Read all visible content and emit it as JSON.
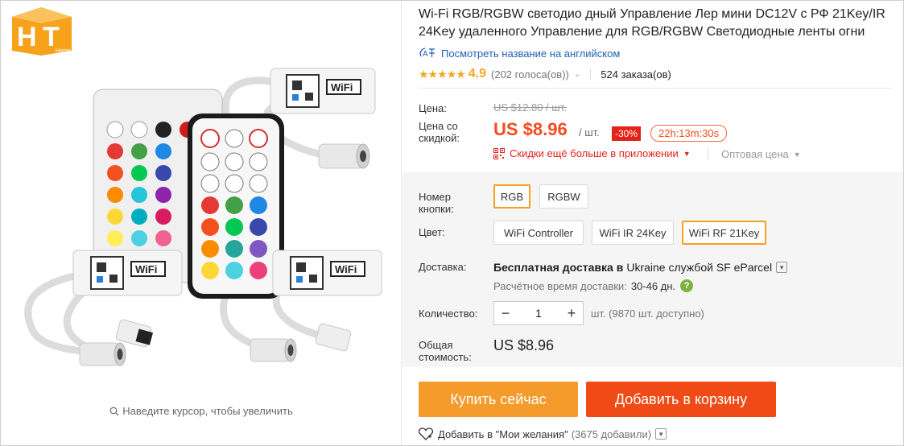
{
  "gallery": {
    "hover_hint": "Наведите курсор, чтобы увеличить",
    "logo_text": "Home"
  },
  "product": {
    "title": "Wi-Fi RGB/RGBW светодио дный Управление Лер мини DC12V с РФ 21Key/IR 24Key удаленного Управление для RGB/RGBW Светодиодные ленты огни",
    "translate_link": "Посмотреть название на английском",
    "translate_icon_text": "A",
    "rating": {
      "stars": "★★★★★",
      "value": "4.9",
      "votes": "(202 голоса(ов))",
      "orders": "524 заказа(ов)"
    }
  },
  "price": {
    "label": "Цена:",
    "original": "US $12.80 / шт.",
    "discount_label": "Цена со скидкой:",
    "current": "US $8.96",
    "unit": "/ шт.",
    "discount": "-30%",
    "timer": "22h:13m:30s",
    "app_promo": "Скидки ещё больше в приложении",
    "wholesale": "Оптовая цена"
  },
  "options": {
    "button_label": "Номер кнопки:",
    "button_options": [
      "RGB",
      "RGBW"
    ],
    "color_label": "Цвет:",
    "color_options": [
      "WiFi Controller",
      "WiFi IR 24Key",
      "WiFi RF 21Key"
    ]
  },
  "shipping": {
    "label": "Доставка:",
    "free_text": "Бесплатная доставка в",
    "destination": "Ukraine службой SF eParcel",
    "time_label": "Расчётное время доставки:",
    "time_value": "30-46 дн."
  },
  "quantity": {
    "label": "Количество:",
    "value": "1",
    "stock": "шт. (9870 шт. доступно)"
  },
  "total": {
    "label": "Общая стоимость:",
    "value": "US $8.96"
  },
  "actions": {
    "buy_now": "Купить сейчас",
    "add_to_cart": "Добавить в корзину",
    "wishlist": "Добавить в \"Мои желания\"",
    "wishlist_count": "(3675 добавили)"
  },
  "colors": {
    "price_red": "#f44b1f",
    "buy_orange": "#f59b2b",
    "cart_red": "#f04a16",
    "star": "#f5a623",
    "link_blue": "#1f5fb4",
    "selected_border": "#f8a01d"
  }
}
